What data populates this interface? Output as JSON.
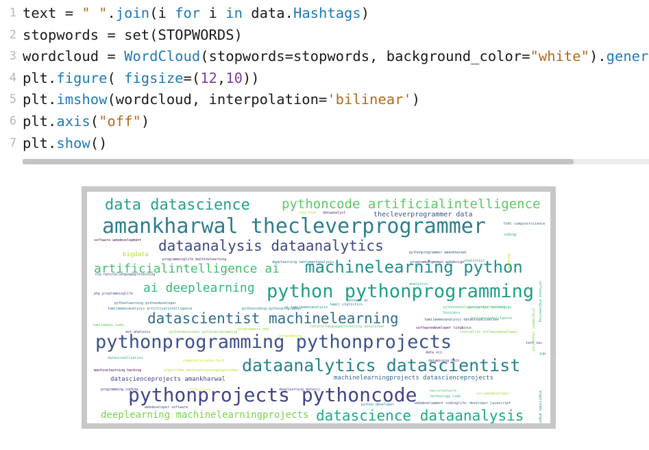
{
  "code": {
    "lines": [
      {
        "n": "1",
        "parts": [
          [
            "ph",
            "text = "
          ],
          [
            "str",
            "\" \""
          ],
          [
            "ph",
            "."
          ],
          [
            "fn",
            "join"
          ],
          [
            "ph",
            "(i "
          ],
          [
            "kw",
            "for"
          ],
          [
            "ph",
            " i "
          ],
          [
            "kw",
            "in"
          ],
          [
            "ph",
            " data."
          ],
          [
            "fn",
            "Hashtags"
          ],
          [
            "ph",
            ")"
          ]
        ]
      },
      {
        "n": "2",
        "parts": [
          [
            "ph",
            "stopwords = set(STOPWORDS)"
          ]
        ]
      },
      {
        "n": "3",
        "parts": [
          [
            "ph",
            "wordcloud = "
          ],
          [
            "fn",
            "WordCloud"
          ],
          [
            "ph",
            "(stopwords=stopwords, background_color="
          ],
          [
            "str",
            "\"white\""
          ],
          [
            "ph",
            ")."
          ],
          [
            "fn",
            "genera"
          ]
        ]
      },
      {
        "n": "4",
        "parts": [
          [
            "ph",
            "plt."
          ],
          [
            "fn",
            "figure"
          ],
          [
            "ph",
            "( "
          ],
          [
            "fn",
            "figsize"
          ],
          [
            "ph",
            "=("
          ],
          [
            "num",
            "12"
          ],
          [
            "ph",
            ","
          ],
          [
            "num",
            "10"
          ],
          [
            "ph",
            "))"
          ]
        ]
      },
      {
        "n": "5",
        "parts": [
          [
            "ph",
            "plt."
          ],
          [
            "fn",
            "imshow"
          ],
          [
            "ph",
            "(wordcloud, interpolation="
          ],
          [
            "str",
            "'bilinear'"
          ],
          [
            "ph",
            ")"
          ]
        ]
      },
      {
        "n": "6",
        "parts": [
          [
            "ph",
            "plt."
          ],
          [
            "fn",
            "axis"
          ],
          [
            "ph",
            "("
          ],
          [
            "str",
            "\"off\""
          ],
          [
            "ph",
            ")"
          ]
        ]
      },
      {
        "n": "7",
        "parts": [
          [
            "ph",
            "plt."
          ],
          [
            "fn",
            "show"
          ],
          [
            "ph",
            "()"
          ]
        ]
      }
    ]
  },
  "colors": {
    "keyword": "#1f7ab8",
    "string": "#b56a1a",
    "number": "#7a3fa0",
    "line_number": "#b5b5b5"
  },
  "wordcloud": {
    "words": [
      {
        "text": "data datascience",
        "size": 22,
        "color": "#2a9d8f"
      },
      {
        "text": "pythoncode artificialintelligence",
        "size": 19,
        "color": "#5cc863"
      },
      {
        "text": "amankharwal thecleverprogrammer",
        "size": 30,
        "color": "#2c7e8e"
      },
      {
        "text": "thecleverprogrammer data",
        "size": 10,
        "color": "#3b528b"
      },
      {
        "text": "dataanalysis dataanalytics",
        "size": 21,
        "color": "#3e4989"
      },
      {
        "text": "artificialintelligence ai",
        "size": 18,
        "color": "#43bf71"
      },
      {
        "text": "machinelearning python",
        "size": 24,
        "color": "#21918c"
      },
      {
        "text": "ai deeplearning",
        "size": 18,
        "color": "#35b779"
      },
      {
        "text": "python pythonprogramming",
        "size": 27,
        "color": "#1f9e89"
      },
      {
        "text": "datascientist machinelearning",
        "size": 21,
        "color": "#2f6c8e"
      },
      {
        "text": "pythonprogramming pythonprojects",
        "size": 27,
        "color": "#3b528b"
      },
      {
        "text": "dataanalytics datascientist",
        "size": 25,
        "color": "#26828e"
      },
      {
        "text": "datascienceprojects amankharwal",
        "size": 9,
        "color": "#414487"
      },
      {
        "text": "machinelearningprojects datascienceprojects",
        "size": 9,
        "color": "#31688e"
      },
      {
        "text": "pythonprojects pythoncode",
        "size": 28,
        "color": "#414487"
      },
      {
        "text": "deeplearning machinelearningprojects",
        "size": 14,
        "color": "#7ad151"
      },
      {
        "text": "datascience dataanalysis",
        "size": 21,
        "color": "#22a884"
      },
      {
        "text": "bigdata",
        "size": 9,
        "color": "#b5de2b"
      },
      {
        "text": "software webdevelopment",
        "size": 5,
        "color": "#440154"
      },
      {
        "text": "programminglife machinelearning",
        "size": 5,
        "color": "#482878"
      },
      {
        "text": "nlp naturallanguageprocessing",
        "size": 5,
        "color": "#3e4989"
      },
      {
        "text": "php programminglife",
        "size": 5,
        "color": "#3b528b"
      },
      {
        "text": "pythonlearning pythondeveloper",
        "size": 5,
        "color": "#31688e"
      },
      {
        "text": "tamilmemesanalysis artificialintelligence",
        "size": 5,
        "color": "#2a788e"
      },
      {
        "text": "tamilmemes code",
        "size": 5,
        "color": "#5ec962"
      },
      {
        "text": "ast analysis",
        "size": 5,
        "color": "#482878"
      },
      {
        "text": "pythondeveloper pythonprogramming",
        "size": 5,
        "color": "#7ad151"
      },
      {
        "text": "programmers php",
        "size": 5,
        "color": "#a0da39"
      },
      {
        "text": "programming",
        "size": 5,
        "color": "#d0e11c"
      },
      {
        "text": "dataviz ai",
        "size": 5,
        "color": "#2c7e8e"
      },
      {
        "text": "datamining tech",
        "size": 5,
        "color": "#46327e"
      },
      {
        "text": "javascript technology",
        "size": 5,
        "color": "#35b779"
      },
      {
        "text": "business",
        "size": 5,
        "color": "#2fb47c"
      },
      {
        "text": "businessintelligence",
        "size": 5,
        "color": "#4ac16d"
      },
      {
        "text": "tech sai",
        "size": 5,
        "color": "#3b528b"
      },
      {
        "text": "job",
        "size": 5,
        "color": "#2a788e"
      },
      {
        "text": "data sci",
        "size": 5,
        "color": "#482878"
      },
      {
        "text": "linux",
        "size": 5,
        "color": "#414487"
      },
      {
        "text": "coding",
        "size": 5,
        "color": "#1f9e89"
      },
      {
        "text": "analytics",
        "size": 5,
        "color": "#22a884"
      },
      {
        "text": "statistics",
        "size": 5,
        "color": "#2c7e8e"
      },
      {
        "text": "deeplearning sentimentanalysis",
        "size": 5,
        "color": "#31688e"
      },
      {
        "text": "programmingmemes webdesign",
        "size": 5,
        "color": "#46327e"
      },
      {
        "text": "pythonprogrammer amankharwal",
        "size": 5,
        "color": "#3e4989"
      },
      {
        "text": "html computerscience",
        "size": 5,
        "color": "#31688e"
      },
      {
        "text": "java html",
        "size": 5,
        "color": "#bddf26"
      },
      {
        "text": "dataanalyst",
        "size": 5,
        "color": "#482878"
      },
      {
        "text": "pythoncoding pythonprogrammer",
        "size": 5,
        "color": "#2a788e"
      },
      {
        "text": "ai tamilmemesanalysis",
        "size": 5,
        "color": "#21918c"
      },
      {
        "text": "naturallanguageprocessing annaturwal",
        "size": 5,
        "color": "#5ec962"
      },
      {
        "text": "softwaredeveloper linux",
        "size": 5,
        "color": "#440154"
      },
      {
        "text": "tamilmemesanalysis datavisualization",
        "size": 5,
        "color": "#3b528b"
      },
      {
        "text": "codinglife softwaredeveloper",
        "size": 5,
        "color": "#7ad151"
      },
      {
        "text": "datavisualization",
        "size": 5,
        "color": "#2fb47c"
      },
      {
        "text": "algorithms machinelearningalgorithms",
        "size": 5,
        "color": "#b5de2b"
      },
      {
        "text": "computerscience tech",
        "size": 5,
        "color": "#d0e11c"
      },
      {
        "text": "machinelearning hacking",
        "size": 5,
        "color": "#440154"
      },
      {
        "text": "programming coding",
        "size": 5,
        "color": "#482878"
      },
      {
        "text": "coder java",
        "size": 5,
        "color": "#fde725"
      },
      {
        "text": "deeplearning datasci",
        "size": 5,
        "color": "#3e4989"
      },
      {
        "text": "neuralnetwork",
        "size": 5,
        "color": "#5ec962"
      },
      {
        "text": "technology code",
        "size": 5,
        "color": "#35b779"
      },
      {
        "text": "css webdeveloper",
        "size": 5,
        "color": "#a0da39"
      },
      {
        "text": "python developer",
        "size": 5,
        "color": "#2c7e8e"
      },
      {
        "text": "webdevelopment codinglife",
        "size": 5,
        "color": "#3b528b"
      },
      {
        "text": "developer javascript",
        "size": 5,
        "color": "#31688e"
      },
      {
        "text": "webdeveloper software",
        "size": 5,
        "color": "#3e4989"
      },
      {
        "text": "analysis tamilmemesanalysis",
        "size": 5,
        "color": "#7ad151"
      },
      {
        "text": "sentimentanalysis sentiment",
        "size": 5,
        "color": "#5ec962"
      },
      {
        "text": "sentiment nlp",
        "size": 5,
        "color": "#482878"
      },
      {
        "text": "technology programming",
        "size": 5,
        "color": "#35b779"
      },
      {
        "text": "code coder",
        "size": 5,
        "color": "#414487"
      },
      {
        "text": "tamil statistics",
        "size": 5,
        "color": "#2a788e"
      },
      {
        "text": "pythondeveloper pythonlearning",
        "size": 5,
        "color": "#4ac16d"
      },
      {
        "text": "database",
        "size": 5,
        "color": "#bddf26"
      },
      {
        "text": "software engineering",
        "size": 5,
        "color": "#2fb47c"
      },
      {
        "text": "programmer javascript",
        "size": 5,
        "color": "#7ad151"
      },
      {
        "text": "linux programmer",
        "size": 5,
        "color": "#31688e"
      },
      {
        "text": "algorithms algorithm",
        "size": 5,
        "color": "#21918c"
      }
    ]
  }
}
